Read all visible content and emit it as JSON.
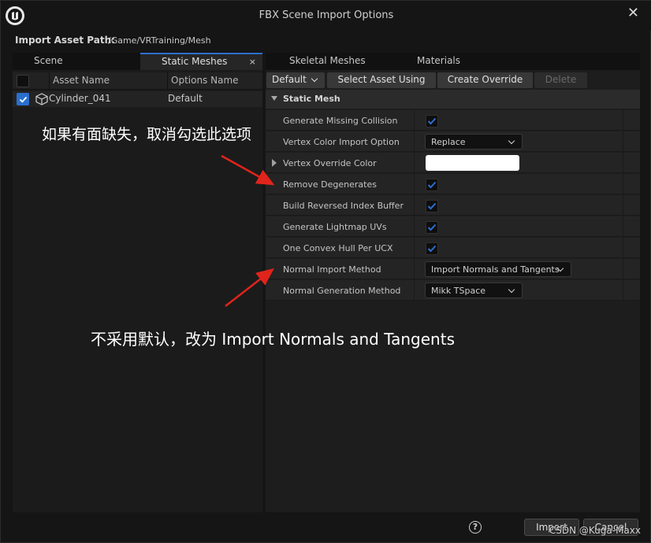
{
  "window": {
    "title": "FBX Scene Import Options",
    "close_glyph": "✕",
    "logo_icon": "unreal-logo-icon"
  },
  "path": {
    "label": "Import Asset Path:",
    "value": "/Game/VRTraining/Mesh"
  },
  "left": {
    "tabs": [
      {
        "label": "Scene"
      },
      {
        "label": "Static Meshes",
        "close": "×"
      }
    ],
    "columns": [
      "Asset Name",
      "Options Name"
    ],
    "rows": [
      {
        "checked": true,
        "name": "Cylinder_041",
        "option": "Default"
      }
    ]
  },
  "right": {
    "tabs": [
      "Skeletal Meshes",
      "Materials"
    ],
    "toolbar": {
      "options_combo": "Default",
      "select_asset_using": "Select Asset Using",
      "create_override": "Create Override",
      "delete": "Delete"
    },
    "section": "Static Mesh",
    "properties": [
      {
        "label": "Generate Missing Collision",
        "type": "checkbox",
        "checked": true
      },
      {
        "label": "Vertex Color Import Option",
        "type": "combo",
        "value": "Replace"
      },
      {
        "label": "Vertex Override Color",
        "type": "color",
        "color": "#ffffff"
      },
      {
        "label": "Remove Degenerates",
        "type": "checkbox",
        "checked": true
      },
      {
        "label": "Build Reversed Index Buffer",
        "type": "checkbox",
        "checked": true
      },
      {
        "label": "Generate Lightmap UVs",
        "type": "checkbox",
        "checked": true
      },
      {
        "label": "One Convex Hull Per UCX",
        "type": "checkbox",
        "checked": true
      },
      {
        "label": "Normal Import Method",
        "type": "combo",
        "value": "Import Normals and Tangents"
      },
      {
        "label": "Normal Generation Method",
        "type": "combo",
        "value": "Mikk TSpace"
      }
    ]
  },
  "footer": {
    "help": "?",
    "import": "Import",
    "cancel": "Cancel",
    "watermark": "CSDN @Kuga-Maxx"
  },
  "annotations": {
    "note1": "如果有面缺失，取消勾选此选项",
    "note2": "不采用默认，改为 Import Normals and Tangents",
    "arrow_color": "#e0241b"
  },
  "colors": {
    "accent": "#2a6fcf",
    "background": "#151515"
  }
}
